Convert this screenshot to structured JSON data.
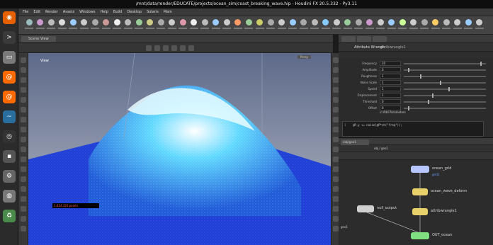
{
  "window": {
    "title": "/mnt/data/render/EDUCATE/projects/ocean_sim/coast_breaking_wave.hip - Houdini FX 20.5.332 - Py3.11"
  },
  "dock": {
    "items": [
      {
        "name": "firefox",
        "color": "#e66000",
        "glyph": "◉"
      },
      {
        "name": "terminal",
        "color": "#3a3a3a",
        "glyph": ">"
      },
      {
        "name": "files",
        "color": "#7a7a7a",
        "glyph": "▭"
      },
      {
        "name": "houdini",
        "color": "#ff6a00",
        "glyph": "@"
      },
      {
        "name": "houdini-alt",
        "color": "#ff6a00",
        "glyph": "@"
      },
      {
        "name": "system-monitor",
        "color": "#2a6e9e",
        "glyph": "~"
      },
      {
        "name": "obs",
        "color": "#333",
        "glyph": "◎"
      },
      {
        "name": "app",
        "color": "#555",
        "glyph": "▪"
      },
      {
        "name": "settings",
        "color": "#666",
        "glyph": "⚙"
      },
      {
        "name": "disk",
        "color": "#777",
        "glyph": "◍"
      },
      {
        "name": "trash",
        "color": "#4a8a4a",
        "glyph": "♻"
      }
    ]
  },
  "menubar": {
    "items": [
      "File",
      "Edit",
      "Render",
      "Assets",
      "Windows",
      "Help",
      "Build",
      "Desktop",
      "Solaris",
      "Main"
    ]
  },
  "viewport": {
    "tab_label": "Scene View",
    "view_label": "View",
    "camera_label": "Persp",
    "stats_text": "1,624,320 points",
    "colors": {
      "sky_top": "#5e6a8a",
      "sky_bottom": "#b7bcc6",
      "ocean": "#1f3fd6",
      "foam": "#e9fbff",
      "crest": "#5fd8ff"
    }
  },
  "params": {
    "node_type": "Attribute Wrangle",
    "node_name": "attribwrangle1",
    "rows": [
      {
        "label": "Frequency",
        "value": "10",
        "pos": 0.95
      },
      {
        "label": "Amplitude",
        "value": "0",
        "pos": 0.05
      },
      {
        "label": "Roughness",
        "value": "1",
        "pos": 0.2
      },
      {
        "label": "Noise Scale",
        "value": "1",
        "pos": 0.45
      },
      {
        "label": "Speed",
        "value": "1",
        "pos": 0.55
      },
      {
        "label": "Displacement",
        "value": "1",
        "pos": 0.35
      },
      {
        "label": "Threshold",
        "value": "0",
        "pos": 0.3
      },
      {
        "label": "Offset",
        "value": "0",
        "pos": 0.05
      }
    ],
    "checkbox_label": "Add Parameters",
    "vex_line_number": "1",
    "vex_code": "@P.y += noise(@P*ch(\"freq\"));"
  },
  "network": {
    "tab_label": "/obj/geo1",
    "path": "obj / geo1",
    "corner_label": "geo1",
    "nodes": [
      {
        "name": "ocean_grid",
        "sub": "grid1",
        "color": "#b8c6ff"
      },
      {
        "name": "ocean_wave_deform",
        "sub": "",
        "color": "#e8d06a"
      },
      {
        "name": "attribwrangle1",
        "sub": "",
        "color": "#e8d06a"
      },
      {
        "name": "null_output",
        "sub": "",
        "color": "#d0d0d0"
      },
      {
        "name": "OUT_ocean",
        "sub": "",
        "color": "#7fe07f"
      }
    ]
  }
}
